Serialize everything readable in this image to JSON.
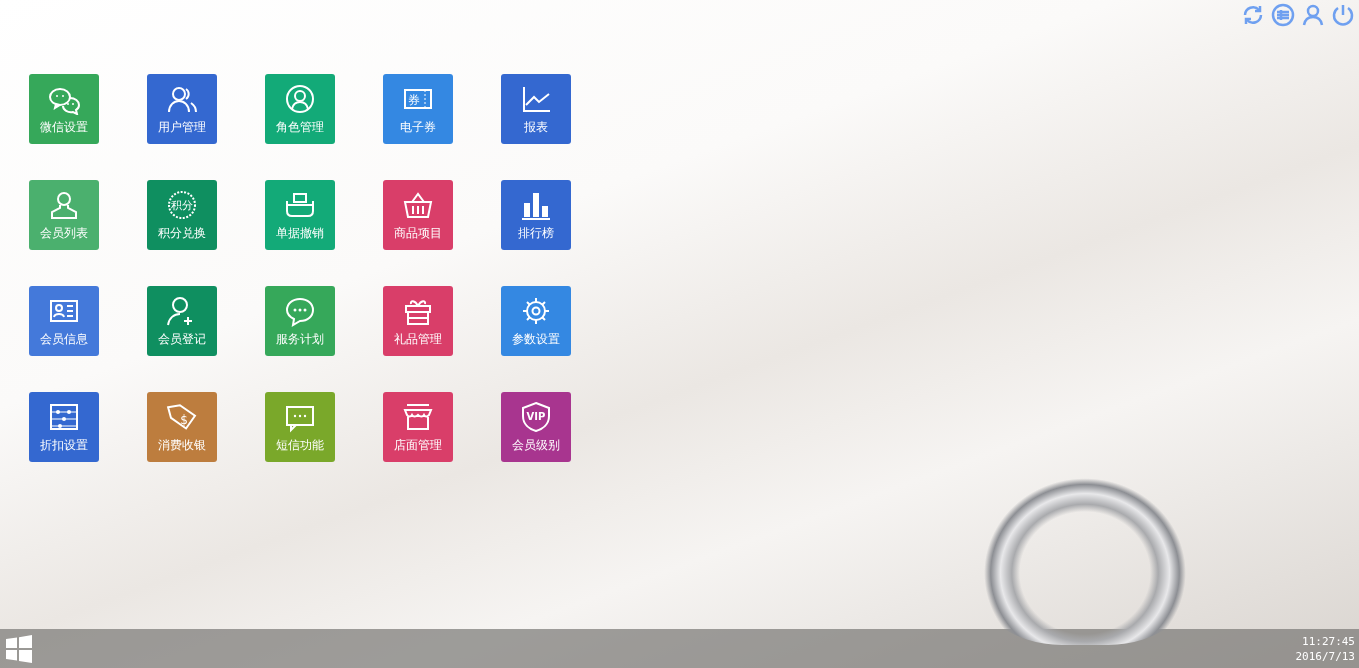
{
  "tiles": [
    {
      "label": "微信设置",
      "color": "#36a85a"
    },
    {
      "label": "用户管理",
      "color": "#3468d0"
    },
    {
      "label": "角色管理",
      "color": "#13aa78"
    },
    {
      "label": "电子券",
      "color": "#3488e2",
      "icon_text": "券"
    },
    {
      "label": "报表",
      "color": "#3468d0"
    },
    {
      "label": "会员列表",
      "color": "#4bb06e"
    },
    {
      "label": "积分兑换",
      "color": "#0f8f60",
      "icon_text": "积分"
    },
    {
      "label": "单据撤销",
      "color": "#13aa78"
    },
    {
      "label": "商品项目",
      "color": "#d93e69"
    },
    {
      "label": "排行榜",
      "color": "#3468d0"
    },
    {
      "label": "会员信息",
      "color": "#4479da"
    },
    {
      "label": "会员登记",
      "color": "#0f8f60"
    },
    {
      "label": "服务计划",
      "color": "#36a85a"
    },
    {
      "label": "礼品管理",
      "color": "#d93e69"
    },
    {
      "label": "参数设置",
      "color": "#3488e2"
    },
    {
      "label": "折扣设置",
      "color": "#3468d0"
    },
    {
      "label": "消费收银",
      "color": "#bd7d3e",
      "icon_text": "$"
    },
    {
      "label": "短信功能",
      "color": "#7aa82a"
    },
    {
      "label": "店面管理",
      "color": "#d93e69"
    },
    {
      "label": "会员级别",
      "color": "#a8358f",
      "icon_text": "VIP"
    }
  ],
  "taskbar": {
    "time": "11:27:45",
    "date": "2016/7/13"
  }
}
